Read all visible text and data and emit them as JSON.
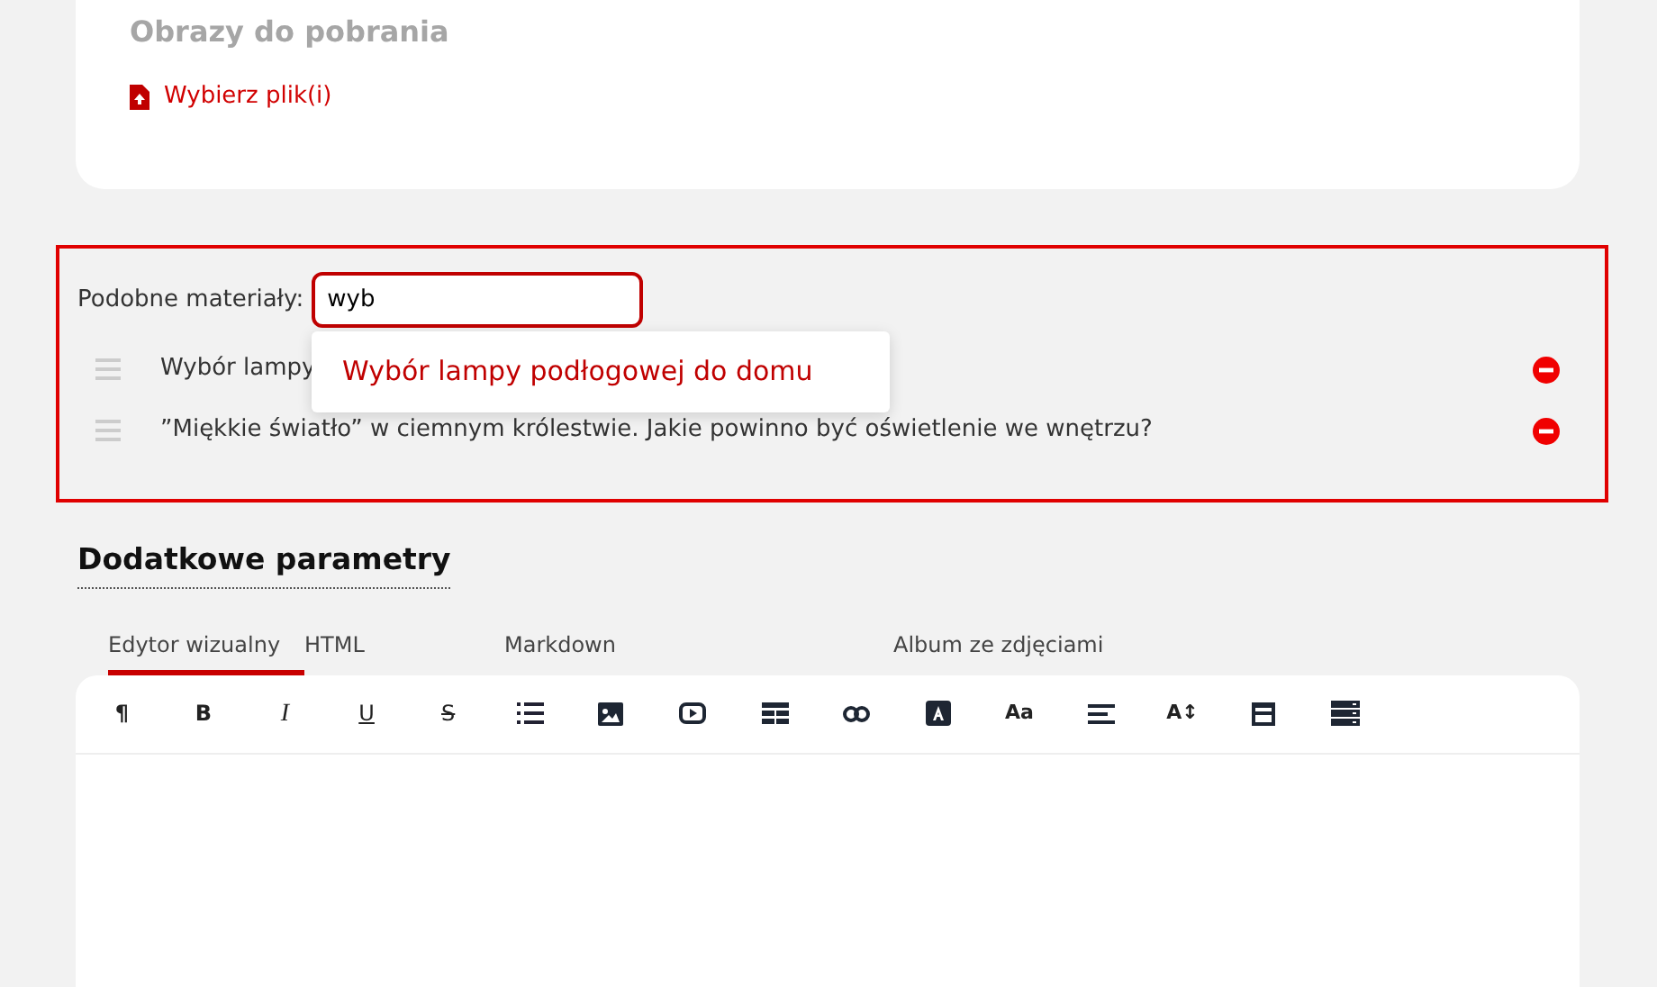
{
  "downloads": {
    "title": "Obrazy do pobrania",
    "choose_link": "Wybierz plik(i)"
  },
  "related": {
    "label": "Podobne materiały:",
    "value": "wyb",
    "suggestions": [
      "Wybór lampy podłogowej do domu"
    ],
    "items": [
      {
        "title": "Wybór lampy"
      },
      {
        "title": "”Miękkie światło” w ciemnym królestwie. Jakie powinno być oświetlenie we wnętrzu?"
      }
    ]
  },
  "extra": {
    "title": "Dodatkowe parametry",
    "tabs": [
      {
        "label": "Edytor wizualny",
        "selected": true
      },
      {
        "label": "HTML",
        "selected": false
      },
      {
        "label": "Markdown",
        "selected": false
      },
      {
        "label": "Album ze zdjęciami",
        "selected": false
      }
    ],
    "toolbar": [
      {
        "kind": "glyph",
        "label": "¶"
      },
      {
        "kind": "glyph",
        "label": "B"
      },
      {
        "kind": "glyph",
        "label": "I"
      },
      {
        "kind": "glyph",
        "label": "U"
      },
      {
        "kind": "glyph",
        "label": "S"
      },
      {
        "kind": "icon"
      },
      {
        "kind": "icon"
      },
      {
        "kind": "icon"
      },
      {
        "kind": "icon"
      },
      {
        "kind": "icon"
      },
      {
        "kind": "icon"
      },
      {
        "kind": "glyph",
        "label": "Aa"
      },
      {
        "kind": "icon"
      },
      {
        "kind": "glyph",
        "label": "A↕"
      },
      {
        "kind": "icon"
      },
      {
        "kind": "icon"
      }
    ]
  }
}
